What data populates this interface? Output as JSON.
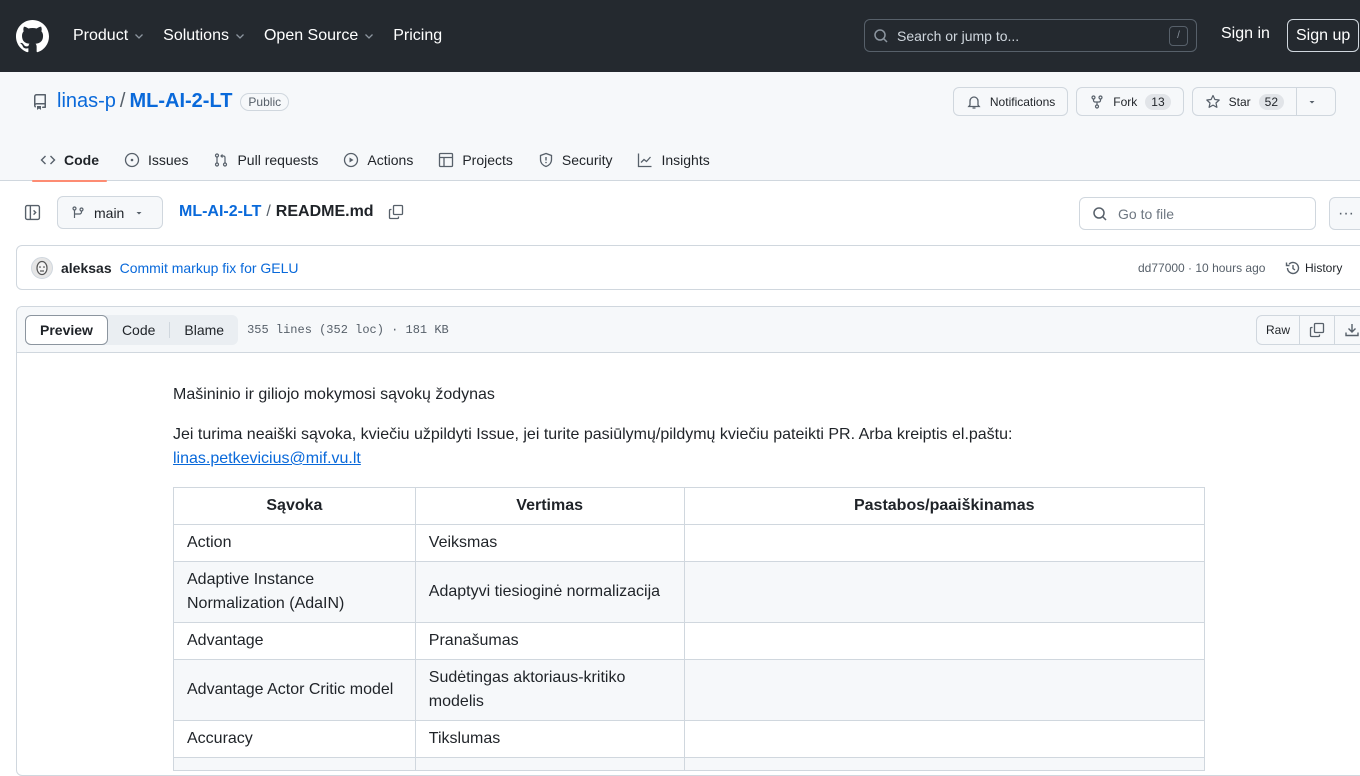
{
  "topbar": {
    "nav": [
      {
        "label": "Product",
        "has_menu": true
      },
      {
        "label": "Solutions",
        "has_menu": true
      },
      {
        "label": "Open Source",
        "has_menu": true
      },
      {
        "label": "Pricing",
        "has_menu": false
      }
    ],
    "search_placeholder": "Search or jump to...",
    "search_shortcut": "/",
    "sign_in": "Sign in",
    "sign_up": "Sign up"
  },
  "repo": {
    "owner": "linas-p",
    "separator": "/",
    "name": "ML-AI-2-LT",
    "visibility": "Public",
    "actions": {
      "notifications": "Notifications",
      "fork": "Fork",
      "fork_count": "13",
      "star": "Star",
      "star_count": "52"
    },
    "tabs": [
      {
        "label": "Code",
        "icon": "code-icon",
        "active": true
      },
      {
        "label": "Issues",
        "icon": "issue-icon",
        "active": false
      },
      {
        "label": "Pull requests",
        "icon": "pull-request-icon",
        "active": false
      },
      {
        "label": "Actions",
        "icon": "play-icon",
        "active": false
      },
      {
        "label": "Projects",
        "icon": "table-icon",
        "active": false
      },
      {
        "label": "Security",
        "icon": "shield-icon",
        "active": false
      },
      {
        "label": "Insights",
        "icon": "graph-icon",
        "active": false
      }
    ]
  },
  "filebar": {
    "branch": "main",
    "crumb_repo": "ML-AI-2-LT",
    "crumb_sep": "/",
    "file_name": "README.md",
    "goto_placeholder": "Go to file",
    "more": "···"
  },
  "commit": {
    "author": "aleksas",
    "message": "Commit markup fix for GELU",
    "meta": "dd77000 · 10 hours ago",
    "history": "History"
  },
  "filebox": {
    "view_tabs": [
      "Preview",
      "Code",
      "Blame"
    ],
    "active_view": "Preview",
    "lines_info": "355 lines (352 loc) · 181 KB",
    "raw": "Raw"
  },
  "readme": {
    "title": "Mašininio ir giliojo mokymosi sąvokų žodynas",
    "intro": "Jei turima neaiški sąvoka, kviečiu užpildyti Issue, jei turite pasiūlymų/pildymų kviečiu pateikti PR. Arba kreiptis el.paštu:",
    "email": "linas.petkevicius@mif.vu.lt",
    "table": {
      "headers": [
        "Sąvoka",
        "Vertimas",
        "Pastabos/paaiškinamas"
      ],
      "rows": [
        [
          "Action",
          "Veiksmas",
          ""
        ],
        [
          "Adaptive Instance Normalization (AdaIN)",
          "Adaptyvi tiesioginė normalizacija",
          ""
        ],
        [
          "Advantage",
          "Pranašumas",
          ""
        ],
        [
          "Advantage Actor Critic model",
          "Sudėtingas aktoriaus-kritiko modelis",
          ""
        ],
        [
          "Accuracy",
          "Tikslumas",
          ""
        ],
        [
          "",
          "",
          ""
        ]
      ]
    }
  }
}
